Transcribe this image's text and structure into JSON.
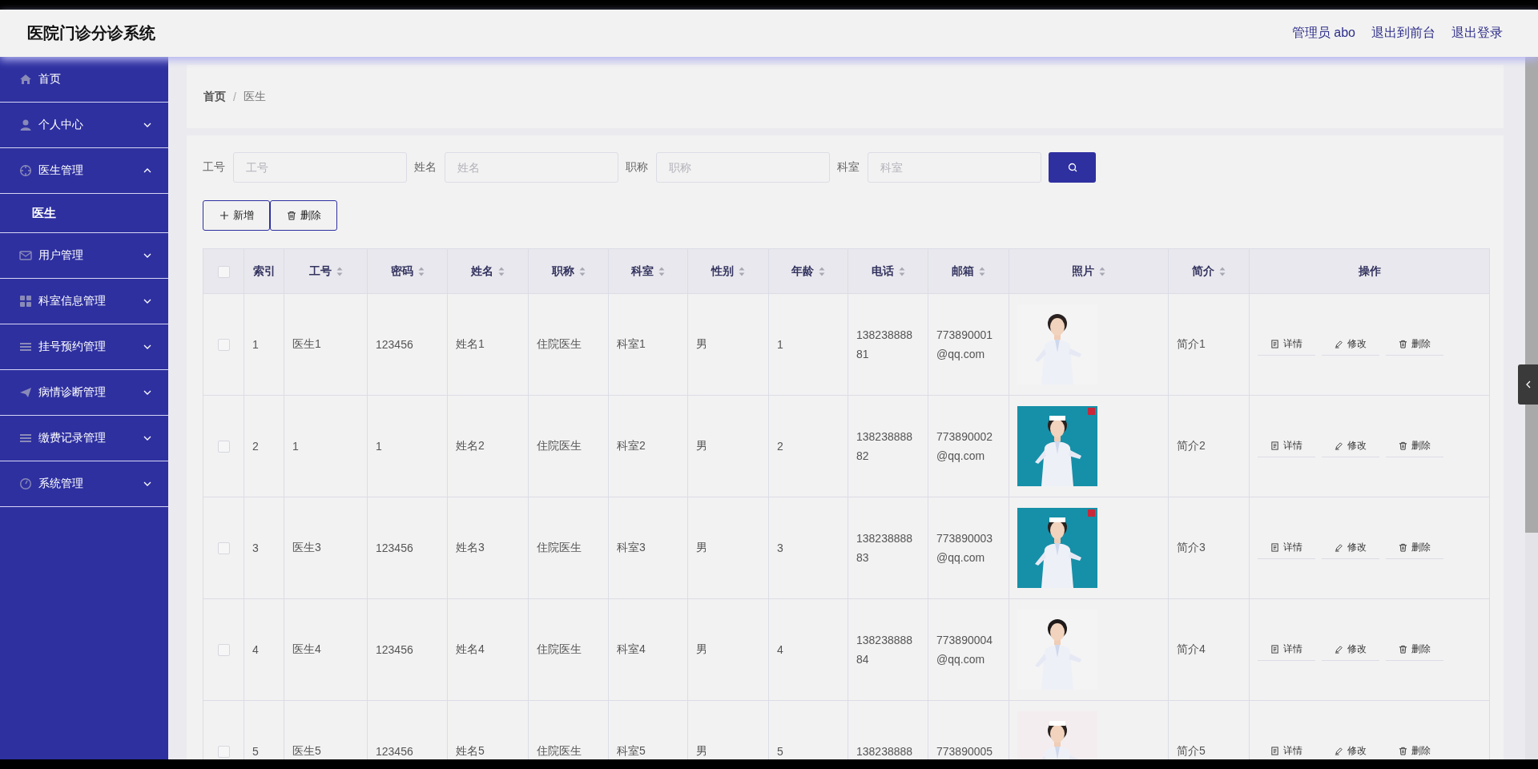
{
  "header": {
    "title": "医院门诊分诊系统",
    "links": [
      "管理员 abo",
      "退出到前台",
      "退出登录"
    ]
  },
  "sidebar": {
    "items": [
      {
        "label": "首页"
      },
      {
        "label": "个人中心",
        "expanded": false
      },
      {
        "label": "医生管理",
        "expanded": true,
        "children": [
          {
            "label": "医生",
            "selected": true
          }
        ]
      },
      {
        "label": "用户管理",
        "expanded": false
      },
      {
        "label": "科室信息管理",
        "expanded": false
      },
      {
        "label": "挂号预约管理",
        "expanded": false
      },
      {
        "label": "病情诊断管理",
        "expanded": false
      },
      {
        "label": "缴费记录管理",
        "expanded": false
      },
      {
        "label": "系统管理",
        "expanded": false
      }
    ]
  },
  "breadcrumb": {
    "items": [
      "首页",
      "医生"
    ],
    "separator": "/"
  },
  "filters": [
    {
      "label": "工号",
      "placeholder": "工号"
    },
    {
      "label": "姓名",
      "placeholder": "姓名"
    },
    {
      "label": "职称",
      "placeholder": "职称"
    },
    {
      "label": "科室",
      "placeholder": "科室"
    }
  ],
  "buttons": [
    {
      "kind": "add",
      "label": "新增"
    },
    {
      "kind": "delete",
      "label": "删除"
    }
  ],
  "table": {
    "all_checked": false,
    "columns": [
      {
        "label": "索引",
        "sortable": false
      },
      {
        "label": "工号",
        "sortable": true
      },
      {
        "label": "密码",
        "sortable": true
      },
      {
        "label": "姓名",
        "sortable": true
      },
      {
        "label": "职称",
        "sortable": true
      },
      {
        "label": "科室",
        "sortable": true
      },
      {
        "label": "性别",
        "sortable": true
      },
      {
        "label": "年龄",
        "sortable": true
      },
      {
        "label": "电话",
        "sortable": true
      },
      {
        "label": "邮箱",
        "sortable": true
      },
      {
        "label": "照片",
        "sortable": true
      },
      {
        "label": "简介",
        "sortable": true
      },
      {
        "label": "操作",
        "sortable": false
      }
    ],
    "rows": [
      {
        "checked": false,
        "cells": [
          "1",
          "医生1",
          "123456",
          "姓名1",
          "住院医生",
          "科室1",
          "男",
          "1",
          "13823888881",
          "773890001@qq.com"
        ],
        "photo": {
          "kind": "picture"
        },
        "intro": "简介1",
        "actions": [
          "详情",
          "修改",
          "删除"
        ]
      },
      {
        "checked": false,
        "cells": [
          "2",
          "1",
          "1",
          "姓名2",
          "住院医生",
          "科室2",
          "男",
          "2",
          "13823888882",
          "773890002@qq.com"
        ],
        "photo": {
          "kind": "picture"
        },
        "intro": "简介2",
        "actions": [
          "详情",
          "修改",
          "删除"
        ]
      },
      {
        "checked": false,
        "cells": [
          "3",
          "医生3",
          "123456",
          "姓名3",
          "住院医生",
          "科室3",
          "男",
          "3",
          "13823888883",
          "773890003@qq.com"
        ],
        "photo": {
          "kind": "picture"
        },
        "intro": "简介3",
        "actions": [
          "详情",
          "修改",
          "删除"
        ]
      },
      {
        "checked": false,
        "cells": [
          "4",
          "医生4",
          "123456",
          "姓名4",
          "住院医生",
          "科室4",
          "男",
          "4",
          "13823888884",
          "773890004@qq.com"
        ],
        "photo": {
          "kind": "picture"
        },
        "intro": "简介4",
        "actions": [
          "详情",
          "修改",
          "删除"
        ]
      },
      {
        "checked": false,
        "cells": [
          "5",
          "医生5",
          "123456",
          "姓名5",
          "住院医生",
          "科室5",
          "男",
          "5",
          "138238888",
          "773890005"
        ],
        "photo": {
          "kind": "picture"
        },
        "intro": "简介5",
        "actions": [
          "详情",
          "修改",
          "删除"
        ]
      }
    ]
  }
}
